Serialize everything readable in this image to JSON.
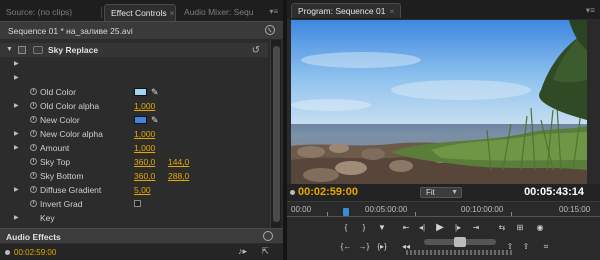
{
  "left_panel": {
    "tabs": [
      {
        "label": "Source: (no clips)"
      },
      {
        "label": "Effect Controls",
        "close": "×"
      },
      {
        "label": "Audio Mixer: Sequ"
      }
    ],
    "menu_glyph": "▾≡",
    "sequence_label": "Sequence 01 * на_заливе 25.avi",
    "effect": {
      "name": "Sky Replace",
      "properties": [
        {
          "label": "Old Color",
          "type": "color",
          "color": "#9fd6f0"
        },
        {
          "label": "Old Color alpha",
          "type": "value",
          "v1": "1,000"
        },
        {
          "label": "New Color",
          "type": "color",
          "color": "#3f86e0"
        },
        {
          "label": "New Color alpha",
          "type": "value",
          "v1": "1,000"
        },
        {
          "label": "Amount",
          "type": "value",
          "v1": "1,000"
        },
        {
          "label": "Sky Top",
          "type": "pair",
          "v1": "360,0",
          "v2": "144,0"
        },
        {
          "label": "Sky Bottom",
          "type": "pair",
          "v1": "360,0",
          "v2": "288,0"
        },
        {
          "label": "Diffuse Gradient",
          "type": "value",
          "v1": "5,00"
        },
        {
          "label": "Invert Grad",
          "type": "checkbox"
        },
        {
          "label": "Key",
          "type": "none"
        }
      ]
    },
    "audio_effects_label": "Audio Effects",
    "timecode": "00:02:59:00"
  },
  "right_panel": {
    "tab_label": "Program: Sequence 01",
    "tab_close": "×",
    "menu_glyph": "▾≡",
    "current_timecode": "00:02:59:00",
    "zoom": "Fit",
    "duration": "00:05:43:14",
    "ruler_ticks": [
      "00:00",
      "00:05:00:00",
      "00:10:00:00",
      "00:15:00"
    ]
  },
  "colors": {
    "accent_timecode": "#e6a800",
    "playhead": "#3a8bd8",
    "old_color": "#9fd6f0",
    "new_color": "#3f86e0"
  }
}
